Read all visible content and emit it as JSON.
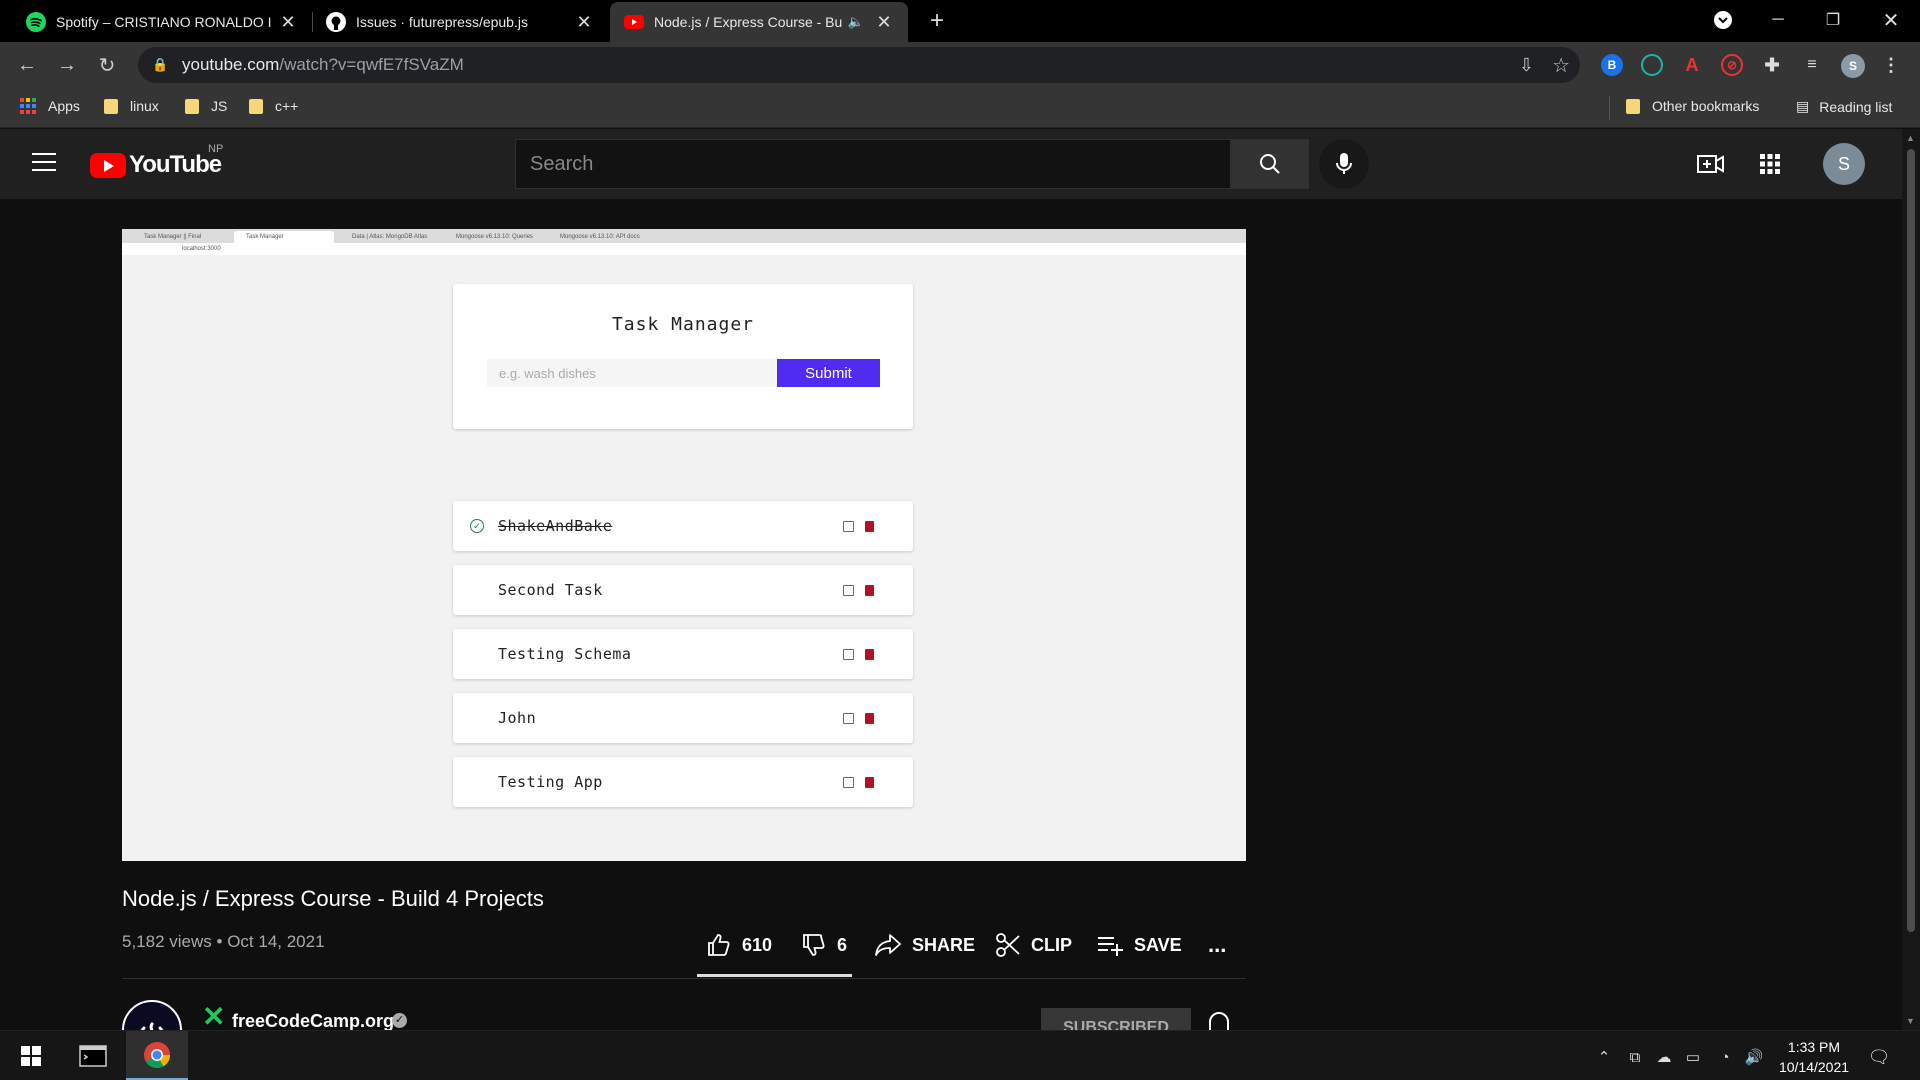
{
  "browser": {
    "tabs": [
      {
        "title": "Spotify – CRISTIANO RONALDO I",
        "icon": "spotify-icon",
        "active": false
      },
      {
        "title": "Issues · futurepress/epub.js",
        "icon": "github-icon",
        "active": false
      },
      {
        "title": "Node.js / Express Course - Bu",
        "icon": "youtube-icon",
        "active": true
      }
    ],
    "new_tab": "+",
    "url_host": "youtube.com",
    "url_path": "/watch?v=qwfE7fSVaZM",
    "profile_initial": "S"
  },
  "bookmarks": {
    "apps": "Apps",
    "folders": [
      "linux",
      "JS",
      "c++"
    ],
    "other": "Other bookmarks",
    "reading_list": "Reading list"
  },
  "youtube": {
    "logo_text": "YouTube",
    "region": "NP",
    "search_placeholder": "Search",
    "avatar_initial": "S"
  },
  "video_frame": {
    "inner_tabs": [
      "Task Manager || Final",
      "Task Manager",
      "Data | Atlas: MongoDB Atlas",
      "Mongoose v6.13.10: Queries",
      "Mongoose v6.13.10: API docs"
    ],
    "inner_url": "localhost:3000",
    "app_title": "Task Manager",
    "input_placeholder": "e.g. wash dishes",
    "submit_label": "Submit",
    "tasks": [
      {
        "name": "ShakeAndBake",
        "completed": true
      },
      {
        "name": "Second Task",
        "completed": false
      },
      {
        "name": "Testing Schema",
        "completed": false
      },
      {
        "name": "John",
        "completed": false
      },
      {
        "name": "Testing App",
        "completed": false
      }
    ]
  },
  "video": {
    "title": "Node.js / Express Course - Build 4 Projects",
    "views": "5,182 views",
    "date": "Oct 14, 2021",
    "meta_sep": "•",
    "likes": "610",
    "dislikes": "6",
    "share": "SHARE",
    "clip": "CLIP",
    "save": "SAVE",
    "more": "..."
  },
  "channel": {
    "name": "freeCodeCamp.org",
    "subscribe_label": "SUBSCRIBED"
  },
  "taskbar": {
    "time": "1:33 PM",
    "date": "10/14/2021"
  }
}
